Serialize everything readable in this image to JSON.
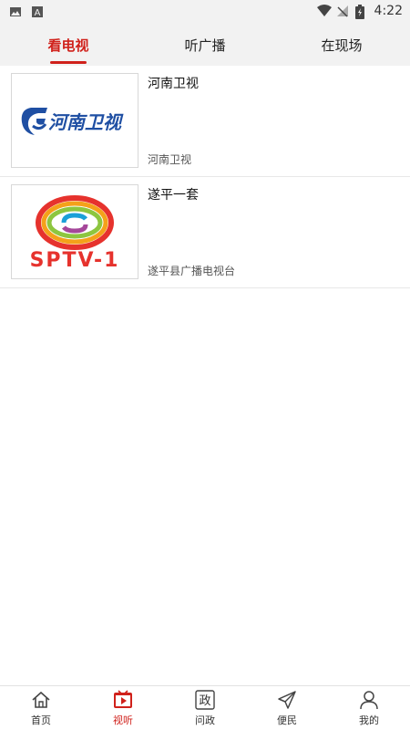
{
  "status_bar": {
    "time": "4:22",
    "icons": [
      "image-icon",
      "a-badge-icon",
      "wifi-icon",
      "no-signal-icon",
      "battery-charging-icon"
    ]
  },
  "tabs": [
    {
      "label": "看电视",
      "active": true
    },
    {
      "label": "听广播",
      "active": false
    },
    {
      "label": "在现场",
      "active": false
    }
  ],
  "channels": [
    {
      "title": "河南卫视",
      "subtitle": "河南卫视",
      "logo_text": "河南卫视",
      "logo_icon": "henan-tv-logo"
    },
    {
      "title": "遂平一套",
      "subtitle": "遂平县广播电视台",
      "logo_text": "SPTV-1",
      "logo_icon": "sptv1-logo"
    }
  ],
  "bottom_nav": [
    {
      "label": "首页",
      "icon": "home-icon",
      "active": false
    },
    {
      "label": "视听",
      "icon": "video-play-icon",
      "active": true
    },
    {
      "label": "问政",
      "icon": "zheng-box-icon",
      "active": false,
      "icon_char": "政"
    },
    {
      "label": "便民",
      "icon": "send-icon",
      "active": false
    },
    {
      "label": "我的",
      "icon": "user-icon",
      "active": false
    }
  ],
  "colors": {
    "accent": "#d0211b",
    "henan_blue": "#1f4fa3",
    "sptv_red": "#e6322d"
  }
}
